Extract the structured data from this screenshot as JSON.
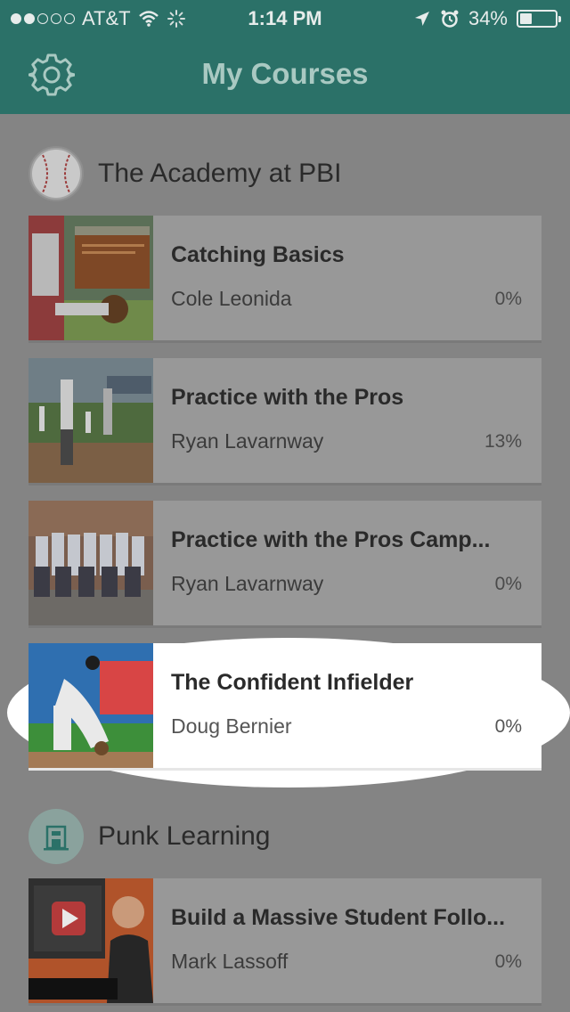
{
  "status": {
    "carrier": "AT&T",
    "time": "1:14 PM",
    "battery_percent": "34%",
    "battery_level": 0.34,
    "signal_bars_filled": 2,
    "signal_bars_total": 5
  },
  "header": {
    "title": "My Courses",
    "settings_icon": "gear-icon"
  },
  "sections": [
    {
      "name": "The Academy at PBI",
      "logo_icon": "baseball-icon",
      "courses": [
        {
          "title": "Catching Basics",
          "author": "Cole Leonida",
          "progress": "0%"
        },
        {
          "title": "Practice with the Pros",
          "author": "Ryan Lavarnway",
          "progress": "13%"
        },
        {
          "title": "Practice with the Pros Camp...",
          "author": "Ryan Lavarnway",
          "progress": "0%"
        },
        {
          "title": "The Confident Infielder",
          "author": "Doug Bernier",
          "progress": "0%"
        }
      ]
    },
    {
      "name": "Punk Learning",
      "logo_icon": "building-icon",
      "courses": [
        {
          "title": "Build a Massive Student Follo...",
          "author": "Mark Lassoff",
          "progress": "0%"
        }
      ]
    }
  ],
  "colors": {
    "header_bg": "#2b7168",
    "header_title": "#a9c9c2",
    "dimmed_bg": "#848484",
    "card_bg": "#989898",
    "highlight": "#ffffff"
  }
}
